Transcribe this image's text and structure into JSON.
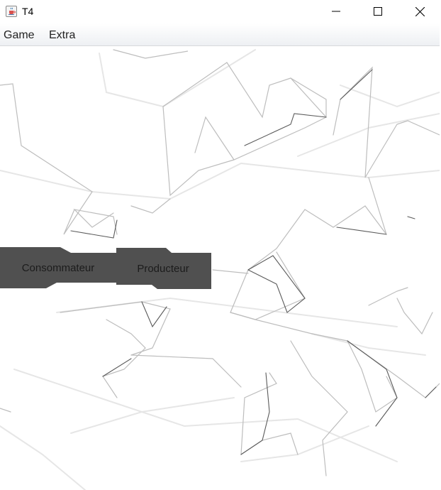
{
  "window": {
    "title": "T4",
    "app_icon": "java-cup-icon",
    "controls": [
      "minimize-icon",
      "maximize-icon",
      "close-icon"
    ]
  },
  "menubar": {
    "items": [
      {
        "label": "Game"
      },
      {
        "label": "Extra"
      }
    ]
  },
  "canvas": {
    "buttons": [
      {
        "label": "Consommateur"
      },
      {
        "label": "Producteur"
      }
    ],
    "colors": {
      "button_bg": "#4f4f4f",
      "button_text": "#1c1c1c",
      "line_dark": "#555555",
      "line_light": "#dddddd"
    }
  }
}
